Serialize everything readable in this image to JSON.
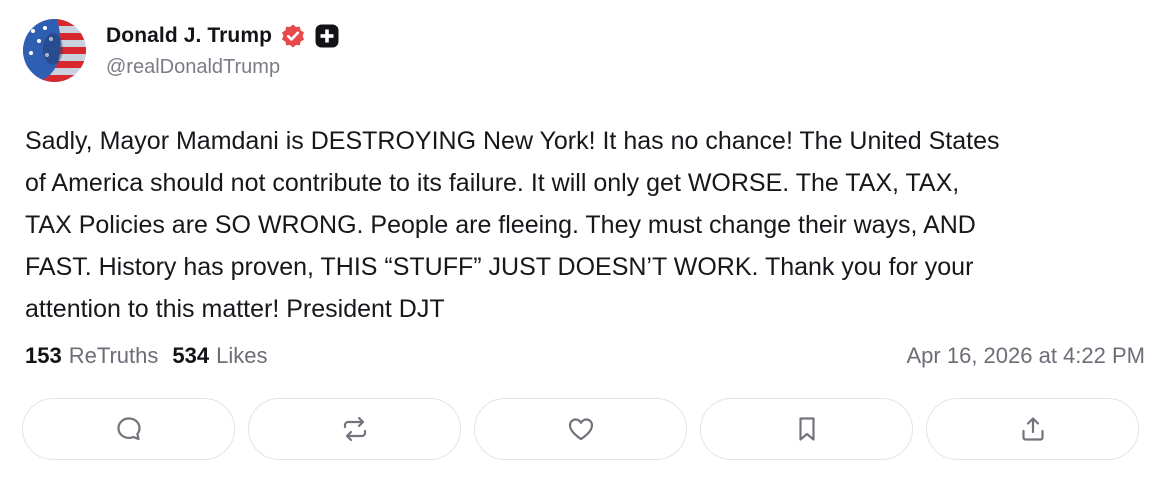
{
  "author": {
    "display_name": "Donald J. Trump",
    "handle": "@realDonaldTrump",
    "verified_color": "#e8494b",
    "badge_icon": "plus-badge-icon",
    "avatar_icon": "flag-portrait-avatar"
  },
  "post": {
    "lines": [
      "Sadly, Mayor Mamdani is DESTROYING New York! It has no chance! The United States",
      "of America should not contribute to its failure. It will only get WORSE. The TAX, TAX,",
      "TAX Policies are SO WRONG. People are fleeing. They must change their ways, AND",
      "FAST. History has proven, THIS “STUFF” JUST DOESN’T WORK. Thank you for your",
      "attention to this matter! President DJT"
    ]
  },
  "stats": {
    "retruths_count": "153",
    "retruths_label": "ReTruths",
    "likes_count": "534",
    "likes_label": "Likes",
    "timestamp": "Apr 16, 2026 at 4:22 PM"
  },
  "actions": [
    {
      "icon": "reply-icon"
    },
    {
      "icon": "retruth-icon"
    },
    {
      "icon": "like-icon"
    },
    {
      "icon": "bookmark-icon"
    },
    {
      "icon": "share-icon"
    }
  ]
}
